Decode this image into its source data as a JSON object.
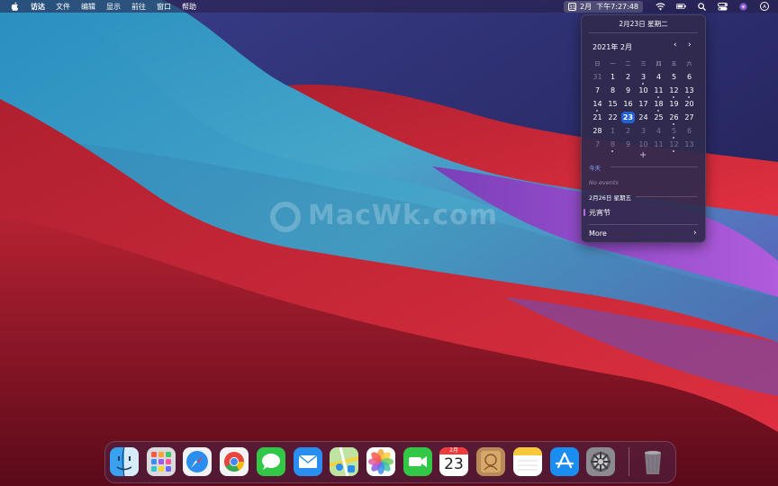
{
  "menubar": {
    "app_name": "访达",
    "menus": [
      "文件",
      "编辑",
      "显示",
      "前往",
      "窗口",
      "帮助"
    ],
    "calendar_glyph": "31",
    "clock_text": "2月  下午7:27:48"
  },
  "watermark": "MacWk.com",
  "calendar": {
    "header_date": "2月23日 星期二",
    "month_title": "2021年 2月",
    "prev_glyph": "‹",
    "next_glyph": "›",
    "weekdays": [
      "日",
      "一",
      "二",
      "三",
      "四",
      "五",
      "六"
    ],
    "weeks": [
      [
        {
          "d": "31",
          "dim": true
        },
        {
          "d": "1"
        },
        {
          "d": "2"
        },
        {
          "d": "3",
          "dot": true
        },
        {
          "d": "4"
        },
        {
          "d": "5"
        },
        {
          "d": "6"
        }
      ],
      [
        {
          "d": "7"
        },
        {
          "d": "8"
        },
        {
          "d": "9"
        },
        {
          "d": "10"
        },
        {
          "d": "11",
          "dot": true
        },
        {
          "d": "12",
          "dot": true
        },
        {
          "d": "13",
          "dot": true
        }
      ],
      [
        {
          "d": "14",
          "dot": true
        },
        {
          "d": "15"
        },
        {
          "d": "16"
        },
        {
          "d": "17"
        },
        {
          "d": "18",
          "dot": true
        },
        {
          "d": "19"
        },
        {
          "d": "20"
        }
      ],
      [
        {
          "d": "21"
        },
        {
          "d": "22"
        },
        {
          "d": "23",
          "today": true
        },
        {
          "d": "24"
        },
        {
          "d": "25"
        },
        {
          "d": "26",
          "dot": true
        },
        {
          "d": "27"
        }
      ],
      [
        {
          "d": "28"
        },
        {
          "d": "1",
          "dim": true
        },
        {
          "d": "2",
          "dim": true
        },
        {
          "d": "3",
          "dim": true
        },
        {
          "d": "4",
          "dim": true
        },
        {
          "d": "5",
          "dim": true,
          "dot": true
        },
        {
          "d": "6",
          "dim": true
        }
      ],
      [
        {
          "d": "7",
          "dim": true
        },
        {
          "d": "8",
          "dim": true,
          "dot": true
        },
        {
          "d": "9",
          "dim": true
        },
        {
          "d": "10",
          "dim": true
        },
        {
          "d": "11",
          "dim": true
        },
        {
          "d": "12",
          "dim": true,
          "dot": true
        },
        {
          "d": "13",
          "dim": true
        }
      ]
    ],
    "add_glyph": "+",
    "today_label": "今天",
    "no_events": "No events",
    "date_section": "2月26日 星期五",
    "event_title": "元宵节",
    "event_color": "#b26de0",
    "more_label": "More",
    "more_glyph": "›"
  },
  "dock": {
    "icons": [
      {
        "name": "finder-icon",
        "kind": "finder"
      },
      {
        "name": "launchpad-icon",
        "kind": "launchpad"
      },
      {
        "name": "safari-icon",
        "kind": "safari"
      },
      {
        "name": "chrome-icon",
        "kind": "chrome"
      },
      {
        "name": "messages-icon",
        "kind": "messages"
      },
      {
        "name": "mail-icon",
        "kind": "mail"
      },
      {
        "name": "maps-icon",
        "kind": "maps"
      },
      {
        "name": "photos-icon",
        "kind": "photos"
      },
      {
        "name": "facetime-icon",
        "kind": "facetime"
      },
      {
        "name": "calendar-app-icon",
        "kind": "calendar",
        "month": "2月",
        "day": "23"
      },
      {
        "name": "contacts-icon",
        "kind": "contacts"
      },
      {
        "name": "notes-icon",
        "kind": "notes"
      },
      {
        "name": "app-store-icon",
        "kind": "appstore"
      },
      {
        "name": "system-preferences-icon",
        "kind": "sysprefs"
      },
      {
        "name": "trash-icon",
        "kind": "trash"
      }
    ]
  }
}
